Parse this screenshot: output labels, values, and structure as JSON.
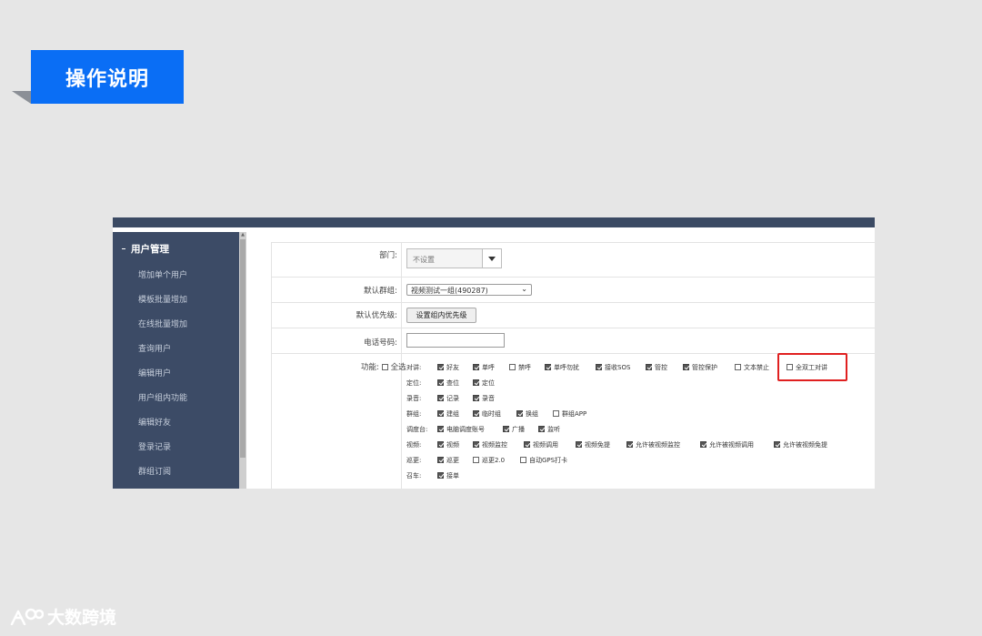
{
  "banner": {
    "title": "操作说明"
  },
  "sidebar": {
    "section": "用户管理",
    "items": [
      "增加单个用户",
      "模板批量增加",
      "在线批量增加",
      "查询用户",
      "编辑用户",
      "用户组内功能",
      "编辑好友",
      "登录记录",
      "群组订阅"
    ]
  },
  "form": {
    "department": {
      "label": "部门:",
      "value": "不设置"
    },
    "default_group": {
      "label": "默认群组:",
      "value": "视频测试一组(490287)"
    },
    "priority": {
      "label": "默认优先级:",
      "button": "设置组内优先级"
    },
    "phone": {
      "label": "电话号码:",
      "value": ""
    },
    "functions": {
      "label": "功能:",
      "select_all": "全选",
      "categories": [
        {
          "name": "对讲:",
          "options": [
            {
              "label": "好友",
              "checked": true
            },
            {
              "label": "单呼",
              "checked": true
            },
            {
              "label": "禁呼",
              "checked": false
            },
            {
              "label": "单呼勿扰",
              "checked": true
            },
            {
              "label": "接收SOS",
              "checked": true
            },
            {
              "label": "管控",
              "checked": true
            },
            {
              "label": "管控保护",
              "checked": true
            },
            {
              "label": "文本禁止",
              "checked": false
            },
            {
              "label": "全双工对讲",
              "checked": false
            }
          ]
        },
        {
          "name": "定位:",
          "options": [
            {
              "label": "查位",
              "checked": true
            },
            {
              "label": "定位",
              "checked": true
            }
          ]
        },
        {
          "name": "录音:",
          "options": [
            {
              "label": "记录",
              "checked": true
            },
            {
              "label": "录音",
              "checked": true
            }
          ]
        },
        {
          "name": "群组:",
          "options": [
            {
              "label": "建组",
              "checked": true
            },
            {
              "label": "临时组",
              "checked": true
            },
            {
              "label": "换组",
              "checked": true
            },
            {
              "label": "群组APP",
              "checked": false
            }
          ]
        },
        {
          "name": "调度台:",
          "options": [
            {
              "label": "电脑调度账号",
              "checked": true
            },
            {
              "label": "广播",
              "checked": true
            },
            {
              "label": "监听",
              "checked": true
            }
          ]
        },
        {
          "name": "视频:",
          "options": [
            {
              "label": "视频",
              "checked": true
            },
            {
              "label": "视频监控",
              "checked": true
            },
            {
              "label": "视频调用",
              "checked": true
            },
            {
              "label": "视频免提",
              "checked": true
            },
            {
              "label": "允许被视频监控",
              "checked": true
            },
            {
              "label": "允许被视频调用",
              "checked": true
            },
            {
              "label": "允许被视频免提",
              "checked": true
            }
          ]
        },
        {
          "name": "巡更:",
          "options": [
            {
              "label": "巡更",
              "checked": true
            },
            {
              "label": "巡更2.0",
              "checked": false
            },
            {
              "label": "自动GPS打卡",
              "checked": false
            }
          ]
        },
        {
          "name": "召车:",
          "options": [
            {
              "label": "接单",
              "checked": true
            }
          ]
        }
      ]
    }
  },
  "watermark": {
    "text": "大数跨境"
  },
  "colors": {
    "banner": "#0a6ef5",
    "sidebar": "#3c4b66",
    "highlight": "#e02020"
  }
}
